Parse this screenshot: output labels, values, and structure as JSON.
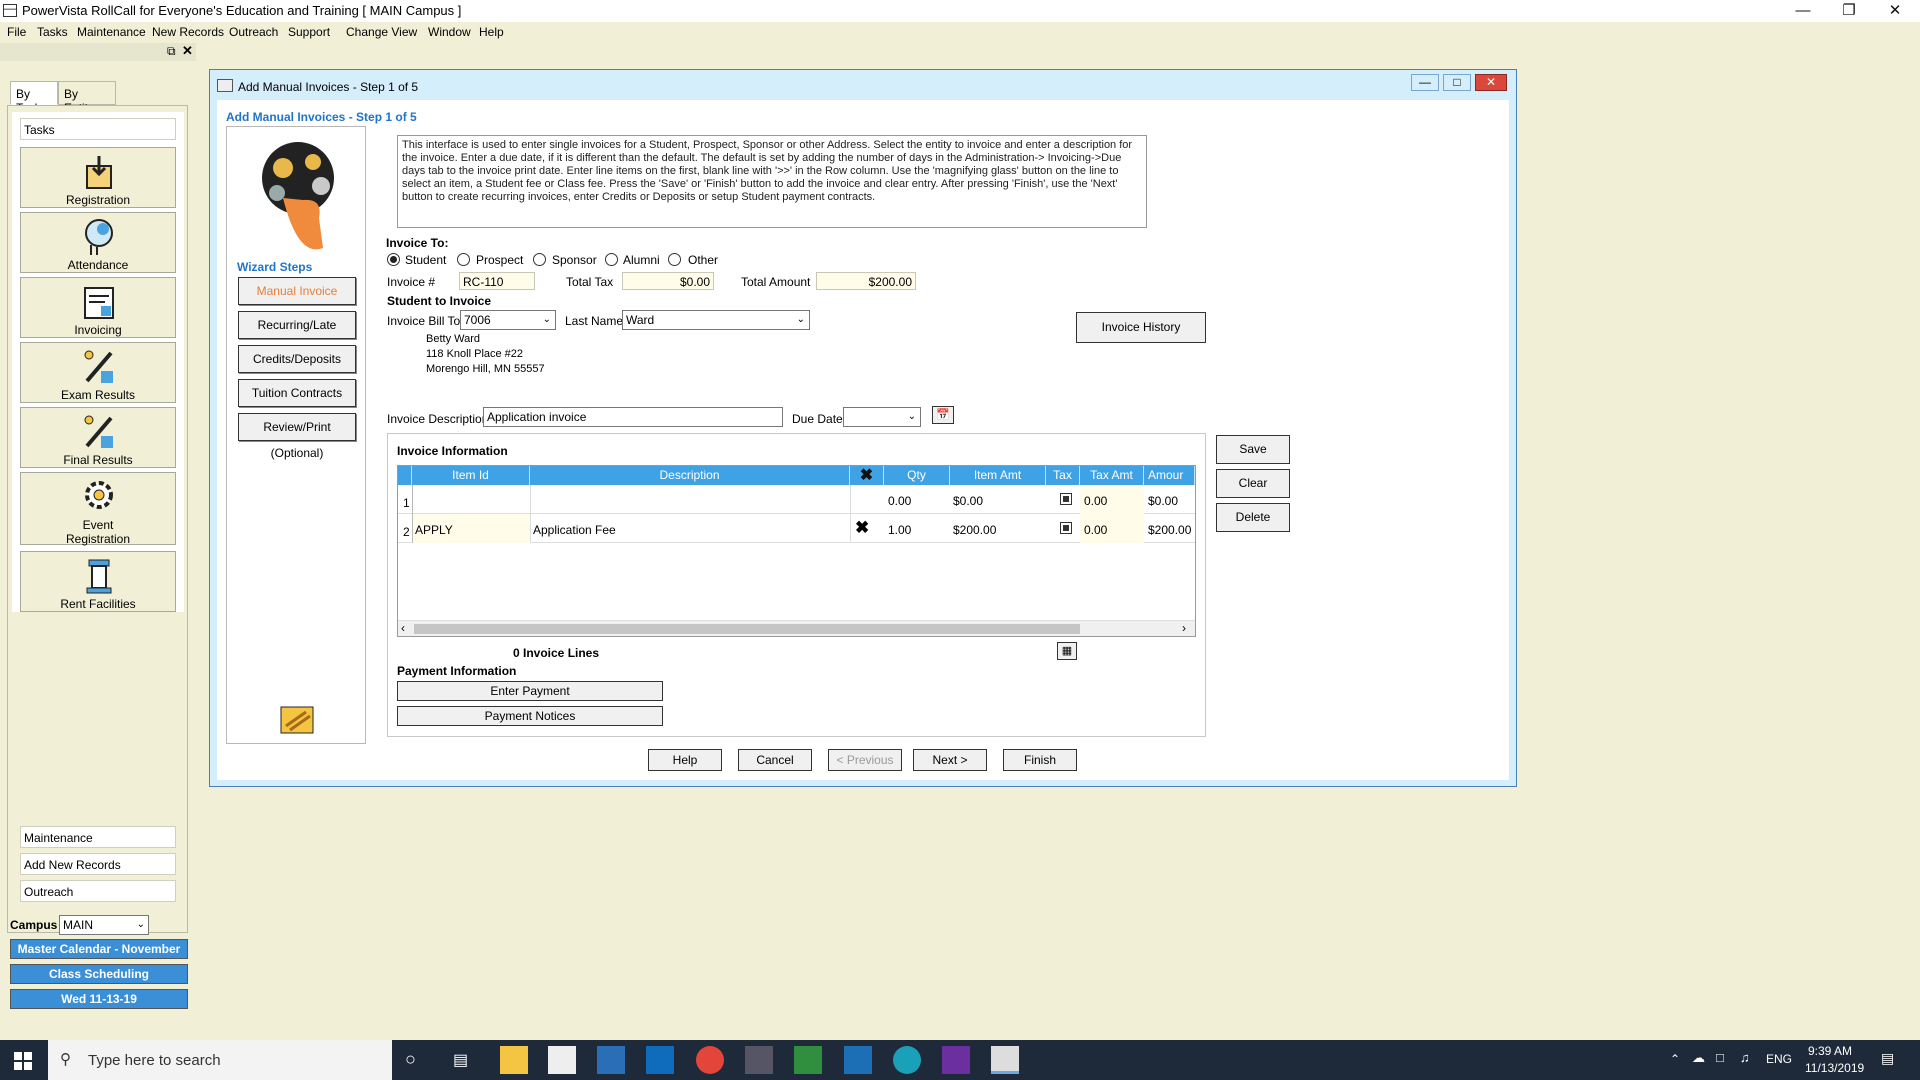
{
  "window": {
    "title": "PowerVista RollCall for Everyone's Education and Training   [ MAIN Campus ]"
  },
  "menu": [
    "File",
    "Tasks",
    "Maintenance",
    "New Records",
    "Outreach",
    "Support",
    "Change View",
    "Window",
    "Help"
  ],
  "sidebar": {
    "tabs": [
      "By Task",
      "By Entity"
    ],
    "tasks_header": "Tasks",
    "items": [
      "Registration",
      "Attendance",
      "Invoicing",
      "Exam Results",
      "Final Results",
      "Event",
      "Registration",
      "Rent Facilities"
    ],
    "bottom": [
      "Maintenance",
      "Add New Records",
      "Outreach"
    ],
    "campus_label": "Campus",
    "campus_value": "MAIN",
    "links": [
      "Master Calendar - November",
      "Class Scheduling",
      "Wed 11-13-19"
    ]
  },
  "dialog": {
    "title": "Add Manual Invoices - Step 1 of 5",
    "heading": "Add Manual Invoices - Step 1 of 5",
    "wizard_label": "Wizard Steps",
    "steps": [
      "Manual Invoice",
      "Recurring/Late Invoice",
      "Credits/Deposits",
      "Tuition Contracts",
      "Review/Print (Optional)"
    ],
    "description": "This interface is used to enter single invoices for a Student, Prospect, Sponsor or other Address. Select the entity to invoice and enter a description for the invoice. Enter a due date, if it is different than the default. The default is set by adding the number of days in the Administration-> Invoicing->Due days tab to the invoice print date. Enter line items on the first, blank line with '>>' in the Row column. Use the 'magnifying glass' button on the line to select an item, a Student fee or Class fee. Press the 'Save' or 'Finish' button to add the invoice and clear entry. After pressing 'Finish', use the 'Next' button to create recurring invoices, enter Credits or Deposits or setup Student payment contracts.",
    "invoice_to_label": "Invoice To:",
    "invoice_to_options": [
      "Student",
      "Prospect",
      "Sponsor",
      "Alumni",
      "Other"
    ],
    "invoice_no_label": "Invoice #",
    "invoice_no": "RC-110",
    "total_tax_label": "Total Tax",
    "total_tax": "$0.00",
    "total_amount_label": "Total Amount",
    "total_amount": "$200.00",
    "student_to_invoice": "Student to Invoice",
    "bill_to_label": "Invoice Bill To:",
    "bill_to": "7006",
    "last_name_label": "Last Name",
    "last_name": "Ward",
    "address": [
      "Betty  Ward",
      "118 Knoll Place #22",
      "Morengo Hill, MN  55557"
    ],
    "invoice_history": "Invoice History",
    "desc_label": "Invoice Description",
    "desc_value": "Application invoice",
    "due_label": "Due Date",
    "invoice_info": "Invoice Information",
    "columns": [
      "Item Id",
      "Description",
      "",
      "Qty",
      "Item Amt",
      "Tax",
      "Tax Amt",
      "Amour"
    ],
    "rows": [
      {
        "n": "1",
        "item": "",
        "desc": "",
        "qty": "0.00",
        "amt": "$0.00",
        "taxamt": "0.00",
        "total": "$0.00"
      },
      {
        "n": "2",
        "item": "APPLY",
        "desc": "Application Fee",
        "qty": "1.00",
        "amt": "$200.00",
        "taxamt": "0.00",
        "total": "$200.00"
      }
    ],
    "lines_count": "0 Invoice Lines",
    "payment_info": "Payment Information",
    "enter_payment": "Enter Payment",
    "payment_notices": "Payment Notices",
    "side_buttons": [
      "Save",
      "Clear",
      "Delete"
    ],
    "footer": [
      "Help",
      "Cancel",
      "< Previous",
      "Next >",
      "Finish"
    ]
  },
  "taskbar": {
    "search": "Type here to search",
    "lang": "ENG",
    "time": "9:39 AM",
    "date": "11/13/2019"
  }
}
